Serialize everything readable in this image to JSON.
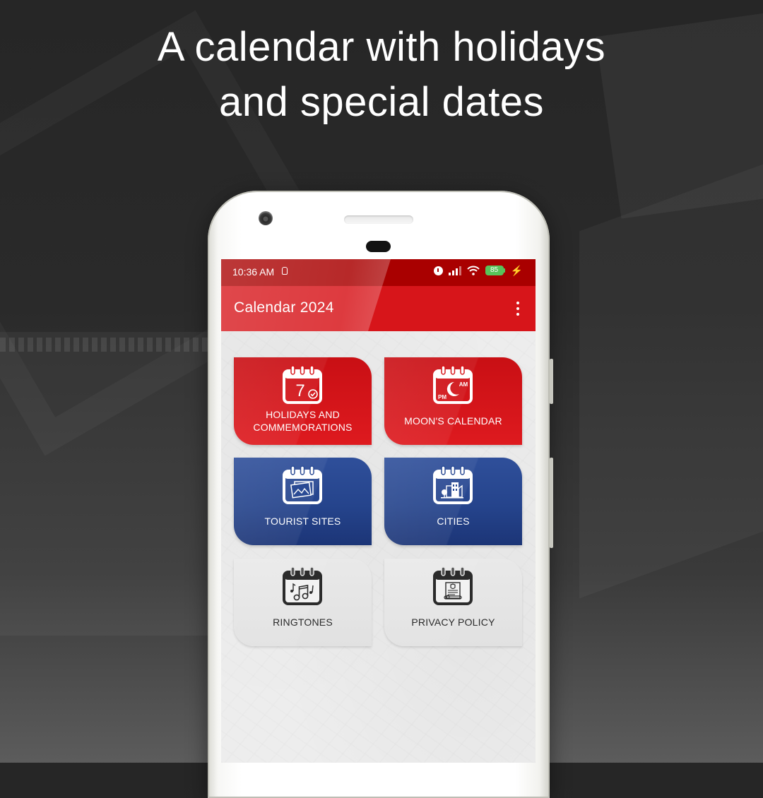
{
  "headline": {
    "line1": "A calendar with holidays",
    "line2": "and special dates"
  },
  "status_bar": {
    "time": "10:36 AM",
    "battery_percent": "85",
    "icons": [
      "sim-icon",
      "alarm-icon",
      "signal-icon",
      "wifi-icon",
      "battery-icon",
      "charging-bolt-icon"
    ]
  },
  "app_bar": {
    "title": "Calendar 2024",
    "menu_icon": "more-vertical-icon"
  },
  "tiles": [
    {
      "label_line1": "HOLIDAYS AND",
      "label_line2": "COMMEMORATIONS",
      "icon": "calendar-day-check-icon",
      "icon_text": "7",
      "color": "#d7151a"
    },
    {
      "label_line1": "MOON'S CALENDAR",
      "icon": "calendar-moon-icon",
      "icon_text_am": "AM",
      "icon_text_pm": "PM",
      "color": "#d7151a"
    },
    {
      "label_line1": "TOURIST SITES",
      "icon": "calendar-photos-icon",
      "color": "#2a4a94"
    },
    {
      "label_line1": "CITIES",
      "icon": "calendar-city-icon",
      "color": "#2a4a94"
    },
    {
      "label_line1": "RINGTONES",
      "icon": "calendar-music-icon",
      "color": "#e5e5e5"
    },
    {
      "label_line1": "PRIVACY POLICY",
      "icon": "calendar-document-icon",
      "color": "#e5e5e5"
    }
  ],
  "colors": {
    "status_bar": "#a90000",
    "app_bar": "#d7151a",
    "tile_red": "#d7151a",
    "tile_blue": "#2a4a94",
    "tile_grey": "#e5e5e5",
    "battery": "#58c45a"
  }
}
